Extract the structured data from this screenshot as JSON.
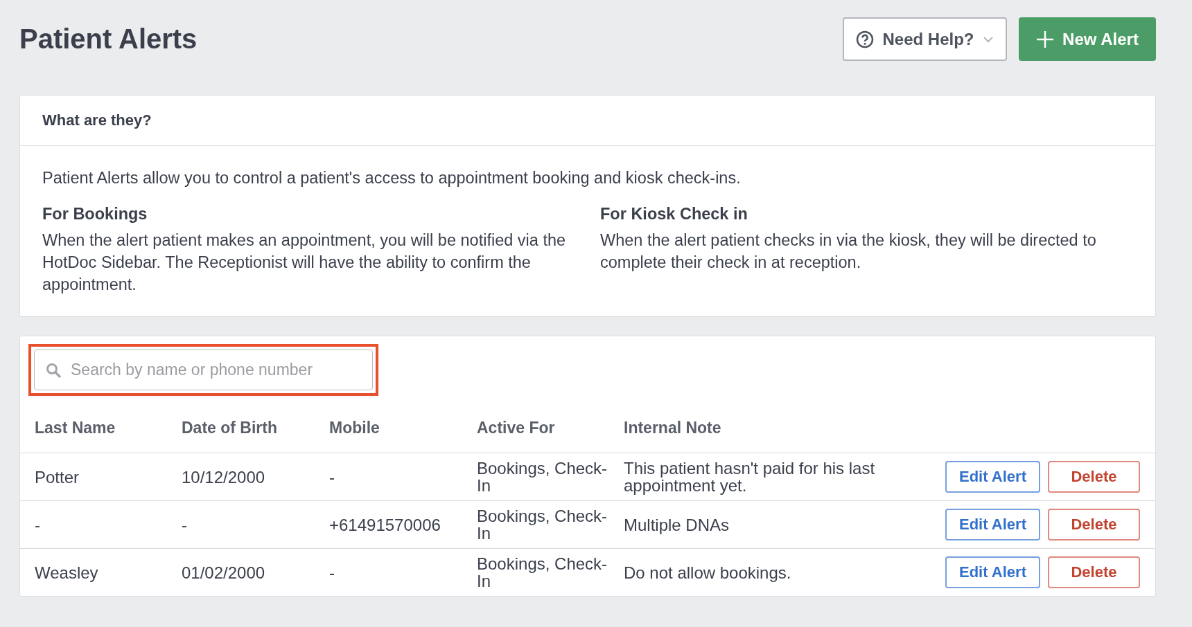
{
  "page": {
    "title": "Patient Alerts"
  },
  "actions": {
    "help": {
      "label": "Need Help?"
    },
    "new_alert": {
      "label": "New Alert"
    }
  },
  "info": {
    "heading": "What are they?",
    "intro": "Patient Alerts allow you to control a patient's access to appointment booking and kiosk check-ins.",
    "sections": [
      {
        "title": "For Bookings",
        "text": "When the alert patient makes an appointment, you will be notified via the HotDoc Sidebar. The Receptionist will have the ability to confirm the appointment."
      },
      {
        "title": "For Kiosk Check in",
        "text": "When the alert patient checks in via the kiosk, they will be directed to complete their check in at reception."
      }
    ]
  },
  "search": {
    "placeholder": "Search by name or phone number",
    "highlighted": true
  },
  "table": {
    "columns": [
      "Last Name",
      "Date of Birth",
      "Mobile",
      "Active For",
      "Internal Note"
    ],
    "rows": [
      {
        "cells": [
          "Potter",
          "10/12/2000",
          "-",
          "Bookings, Check-In",
          "This patient hasn't paid for his last appointment yet."
        ],
        "edit": "Edit Alert",
        "delete": "Delete"
      },
      {
        "cells": [
          "-",
          "-",
          "+61491570006",
          "Bookings, Check-In",
          "Multiple DNAs"
        ],
        "edit": "Edit Alert",
        "delete": "Delete"
      },
      {
        "cells": [
          "Weasley",
          "01/02/2000",
          "-",
          "Bookings, Check-In",
          "Do not allow bookings."
        ],
        "edit": "Edit Alert",
        "delete": "Delete"
      }
    ]
  }
}
